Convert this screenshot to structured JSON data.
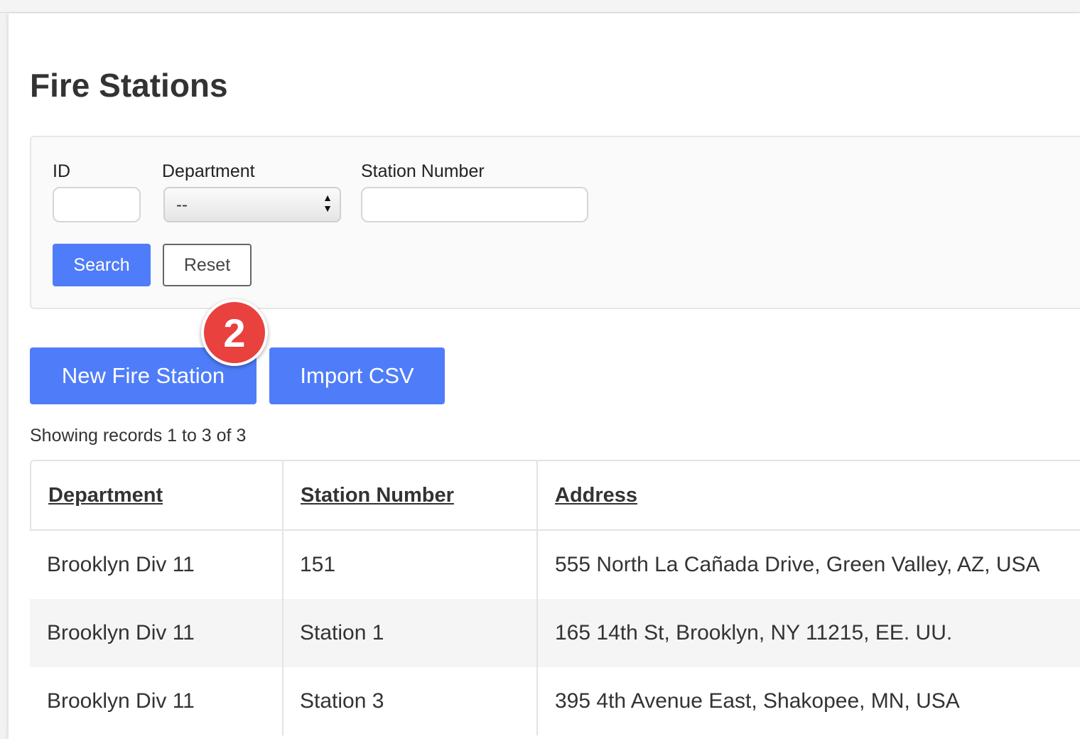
{
  "page": {
    "title": "Fire Stations"
  },
  "filters": {
    "id_label": "ID",
    "id_value": "",
    "department_label": "Department",
    "department_selected": "--",
    "station_number_label": "Station Number",
    "station_number_value": "",
    "search_label": "Search",
    "reset_label": "Reset"
  },
  "actions": {
    "new_label": "New Fire Station",
    "import_label": "Import CSV"
  },
  "annotation": {
    "step": "2",
    "color": "#e8413e"
  },
  "records_info": "Showing records 1 to 3 of 3",
  "table": {
    "columns": [
      "Department",
      "Station Number",
      "Address"
    ],
    "rows": [
      [
        "Brooklyn Div 11",
        "151",
        "555 North La Cañada Drive, Green Valley, AZ, USA"
      ],
      [
        "Brooklyn Div 11",
        "Station 1",
        "165 14th St, Brooklyn, NY 11215, EE. UU."
      ],
      [
        "Brooklyn Div 11",
        "Station 3",
        "395 4th Avenue East, Shakopee, MN, USA"
      ]
    ]
  },
  "colors": {
    "primary": "#4f7df9",
    "badge": "#e8413e"
  }
}
